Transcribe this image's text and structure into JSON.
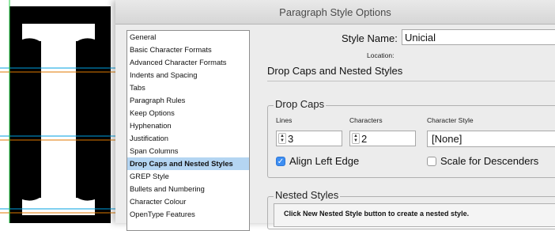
{
  "dialog": {
    "title": "Paragraph Style Options"
  },
  "categories": [
    {
      "label": "General"
    },
    {
      "label": "Basic Character Formats"
    },
    {
      "label": "Advanced Character Formats"
    },
    {
      "label": "Indents and Spacing"
    },
    {
      "label": "Tabs"
    },
    {
      "label": "Paragraph Rules"
    },
    {
      "label": "Keep Options"
    },
    {
      "label": "Hyphenation"
    },
    {
      "label": "Justification"
    },
    {
      "label": "Span Columns"
    },
    {
      "label": "Drop Caps and Nested Styles",
      "selected": true
    },
    {
      "label": "GREP Style"
    },
    {
      "label": "Bullets and Numbering"
    },
    {
      "label": "Character Colour"
    },
    {
      "label": "OpenType Features"
    }
  ],
  "style_name": {
    "label": "Style Name:",
    "value": "Unicial"
  },
  "location": {
    "label": "Location:"
  },
  "section": {
    "title": "Drop Caps and Nested Styles"
  },
  "drop_caps": {
    "group_label": "Drop Caps",
    "lines_label": "Lines",
    "lines_value": "3",
    "characters_label": "Characters",
    "characters_value": "2",
    "character_style_label": "Character Style",
    "character_style_value": "[None]",
    "align_left_edge_label": "Align Left Edge",
    "align_left_edge_checked": true,
    "scale_for_descenders_label": "Scale for Descenders",
    "scale_for_descenders_checked": false
  },
  "nested_styles": {
    "group_label": "Nested Styles",
    "message": "Click New Nested Style button to create a nested style."
  },
  "canvas": {
    "glyph": "I",
    "guide_color_cyan": "#00a0e0",
    "guide_color_orange": "#e07a00",
    "guide_color_green": "#22cc44"
  }
}
